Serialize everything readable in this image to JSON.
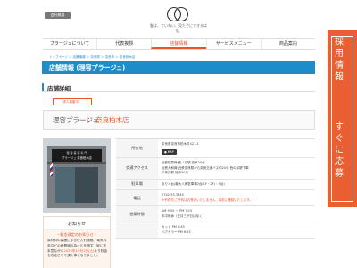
{
  "header": {
    "corp_badge": "会社概要",
    "logo_text": "髪は、ていねい、見たぞにできるはず。"
  },
  "nav": {
    "items": [
      "プラージュについて",
      "代表挨拶",
      "店舗情報",
      "サービスメニュー",
      "商品案内"
    ],
    "active_index": 2
  },
  "breadcrumb": {
    "text": "トップページ ＞ 店舗情報 ＞ 奈良県 ＞ 奈良市 ＞ 奈良柏木店"
  },
  "page": {
    "title": "店舗情報 (理容プラージュ)",
    "section_title": "店舗詳細"
  },
  "hiring_badge": "求人募集中！",
  "shop": {
    "prefix": "理容プラージュ",
    "name": "奈良柏木店"
  },
  "photo": {
    "sign_top": "理 容 美 容 専 門",
    "sign_text": "プラージュ 奈良柏木店"
  },
  "notice": {
    "header": "お知らせ",
    "title": "・料金改定のお知らせ・",
    "body_1": "原材料の高騰による仕入れ価格、電気料金などの経費増の為止むを得ず、誠に不本意ながら",
    "date": "2022年10月1日(土)",
    "body_2": "より料金を改定させて頂く事となりました。"
  },
  "table": {
    "rows": [
      {
        "label": "所在地",
        "lines": [
          "奈良県奈良市柏木町421-1"
        ],
        "map_label": "MAP"
      },
      {
        "label": "交通アクセス",
        "lines": [
          "近鉄橿原線 西ノ京駅 徒歩20分",
          "近鉄大和線 近鉄奈良駅から奈良交通バス約20分 西の京駅下車",
          "JR奈良駅 徒歩20分"
        ]
      },
      {
        "label": "駐車場",
        "lines": [
          "あり 6台(最大八条駐車場2台(1F・2F)・5台)"
        ]
      },
      {
        "label": "電話",
        "lines": [
          "0742-33-3645"
        ],
        "red": "※予約可(ご予約はお受けいたしません。事前に確認いたします。)"
      },
      {
        "label": "営業時間",
        "lines": [
          "AM 9:00 ～ PM 7:15",
          "年中無休（正月三が日は除く）"
        ]
      },
      {
        "label": "",
        "lines": [
          "カット PM 6:45",
          "ヘアカラー PM 6:15"
        ]
      }
    ]
  },
  "side_cta": {
    "line1": "採用情報",
    "line2": "すぐに応募"
  },
  "colors": {
    "accent": "#e8542c",
    "brand_blue": "#1d8ccb",
    "cta": "#ea5f31"
  }
}
